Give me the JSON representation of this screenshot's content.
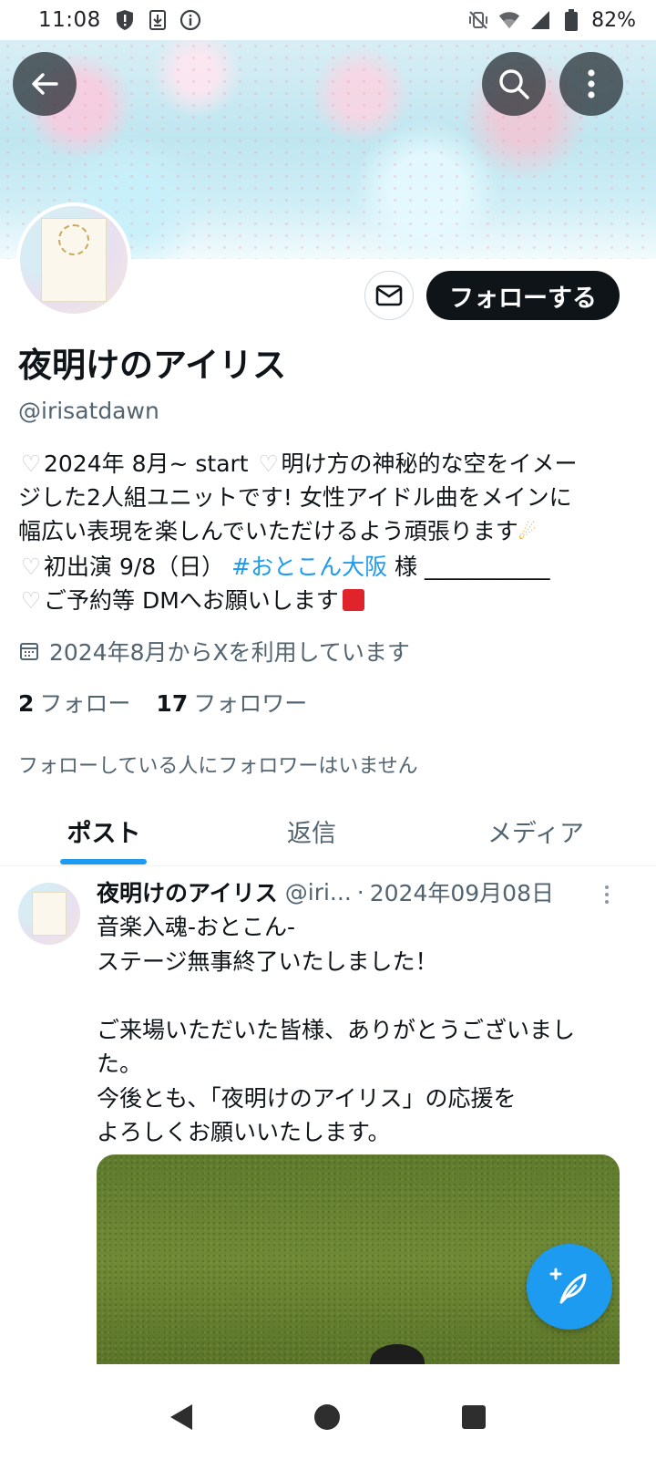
{
  "status_bar": {
    "time": "11:08",
    "battery": "82%",
    "icons": [
      "shield-alert-icon",
      "download-icon",
      "info-icon",
      "vibrate-off-icon",
      "wifi-icon",
      "signal-icon",
      "battery-icon"
    ]
  },
  "header": {
    "icons": [
      "back-arrow-icon",
      "search-icon",
      "more-vertical-icon"
    ]
  },
  "profile": {
    "display_name": "夜明けのアイリス",
    "handle": "@irisatdawn",
    "follow_label": "フォローする",
    "bio": {
      "line1_text": "2024年 8月~ start ",
      "line1_text2": "明け方の神秘的な空をイメー",
      "line2": "ジした2人組ユニットです! 女性アイドル曲をメインに",
      "line3": "幅広い表現を楽しんでいただけるよう頑張ります",
      "line4_pre": "初出演 9/8（日） ",
      "line4_hashtag": "#おとこん大阪",
      "line4_post": " 様 ___________",
      "line5": "ご予約等 DMへお願いします"
    },
    "joined": "2024年8月からXを利用しています",
    "following_count": "2",
    "following_label": "フォロー",
    "followers_count": "17",
    "followers_label": "フォロワー",
    "no_mutual_followers": "フォローしている人にフォロワーはいません"
  },
  "tabs": [
    {
      "label": "ポスト",
      "active": true
    },
    {
      "label": "返信",
      "active": false
    },
    {
      "label": "メディア",
      "active": false
    }
  ],
  "post": {
    "name": "夜明けのアイリス",
    "handle": "@iri...",
    "separator": "·",
    "date": "2024年09月08日",
    "lines": [
      "音楽入魂-おとこん-",
      "ステージ無事終了いたしました！",
      "",
      "ご来場いただいた皆様、ありがとうございまし",
      "た。",
      "今後とも、「夜明けのアイリス」の応援を",
      "よろしくお願いいたします。"
    ]
  },
  "colors": {
    "accent": "#1d9bf0",
    "text_primary": "#0f1419",
    "text_secondary": "#536471",
    "follow_button_bg": "#0f1419"
  }
}
